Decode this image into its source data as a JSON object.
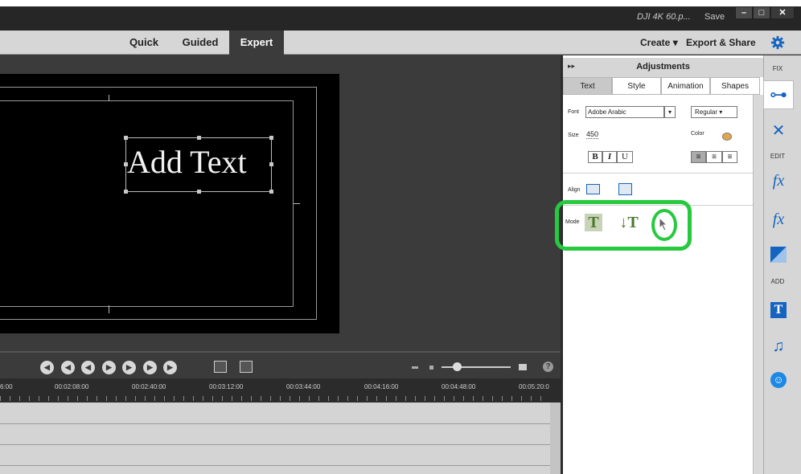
{
  "titlebar": {
    "filename": "DJI 4K 60.p...",
    "save_label": "Save",
    "minimize": "–",
    "maximize": "□",
    "close": "✕"
  },
  "modebar": {
    "tabs": [
      {
        "label": "Quick"
      },
      {
        "label": "Guided"
      },
      {
        "label": "Expert",
        "active": true
      }
    ],
    "create_label": "Create ▾",
    "export_label": "Export & Share",
    "settings_icon": "gear-icon"
  },
  "monitor": {
    "title_text": "Add Text"
  },
  "timeline": {
    "timecodes": [
      "6:00",
      "00:02:08:00",
      "00:02:40:00",
      "00:03:12:00",
      "00:03:44:00",
      "00:04:16:00",
      "00:04:48:00",
      "00:05:20:0"
    ],
    "transport_icons": [
      "go-to-start-icon",
      "rewind-icon",
      "step-back-icon",
      "play-icon",
      "step-forward-icon",
      "fast-forward-icon",
      "go-to-end-icon"
    ],
    "help_label": "?"
  },
  "adjustments": {
    "title": "Adjustments",
    "collapse_label": "▸▸",
    "tabs": [
      "Text",
      "Style",
      "Animation",
      "Shapes"
    ],
    "active_tab": "Text",
    "font_label": "Font",
    "font_value": "Adobe Arabic",
    "style_value": "Regular",
    "size_label": "Size",
    "size_value": "450",
    "color_label": "Color",
    "bold": "B",
    "italic": "I",
    "underline": "U",
    "align_label": "Align",
    "mode_label": "Mode"
  },
  "toolbar": {
    "fix_label": "FIX",
    "edit_label": "EDIT",
    "add_label": "ADD"
  },
  "colors": {
    "highlight": "#27c93f",
    "accent": "#1565c0"
  }
}
